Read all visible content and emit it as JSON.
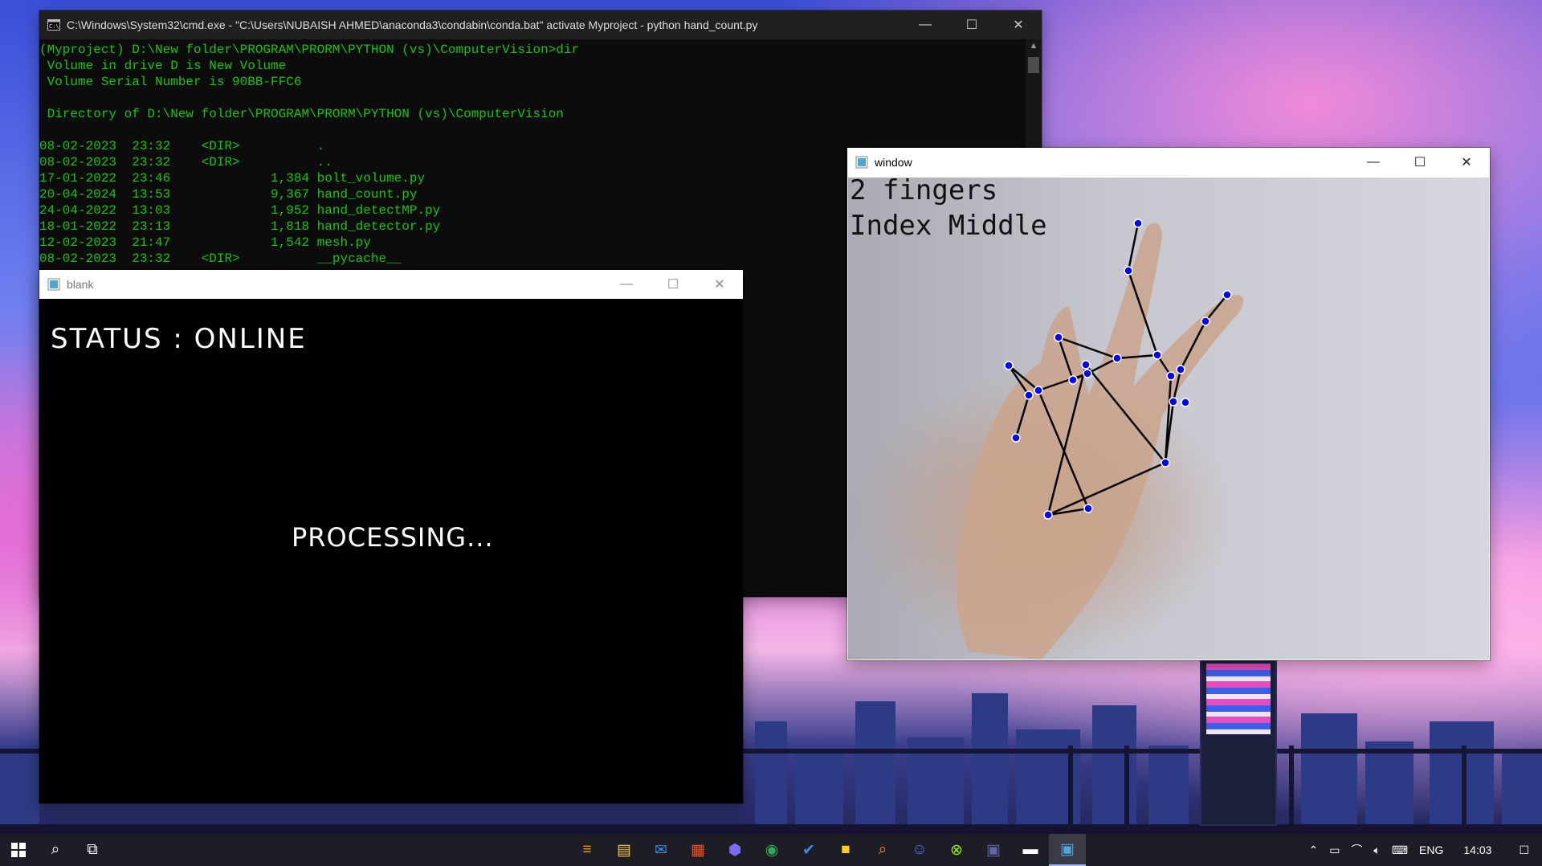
{
  "cmd": {
    "title": "C:\\Windows\\System32\\cmd.exe - \"C:\\Users\\NUBAISH AHMED\\anaconda3\\condabin\\conda.bat\"  activate Myproject - python  hand_count.py",
    "lines": [
      "(Myproject) D:\\New folder\\PROGRAM\\PRORM\\PYTHON (vs)\\ComputerVision>dir",
      " Volume in drive D is New Volume",
      " Volume Serial Number is 90BB-FFC6",
      "",
      " Directory of D:\\New folder\\PROGRAM\\PRORM\\PYTHON (vs)\\ComputerVision",
      "",
      "08-02-2023  23:32    <DIR>          .",
      "08-02-2023  23:32    <DIR>          ..",
      "17-01-2022  23:46             1,384 bolt_volume.py",
      "20-04-2024  13:53             9,367 hand_count.py",
      "24-04-2022  13:03             1,952 hand_detectMP.py",
      "18-01-2022  23:13             1,818 hand_detector.py",
      "12-02-2023  21:47             1,542 mesh.py",
      "08-02-2023  23:32    <DIR>          __pycache__"
    ]
  },
  "blank": {
    "title": "blank",
    "status": "STATUS : ONLINE",
    "processing": "PROCESSING..."
  },
  "camera": {
    "title": "window",
    "finger_count_text": "2 fingers",
    "finger_names_text": "Index Middle"
  },
  "taskbar": {
    "time": "14:03",
    "language": "ENG"
  },
  "colors": {
    "console_text": "#16c60c",
    "landmark_point": "#0000ff",
    "landmark_line": "#000000"
  }
}
